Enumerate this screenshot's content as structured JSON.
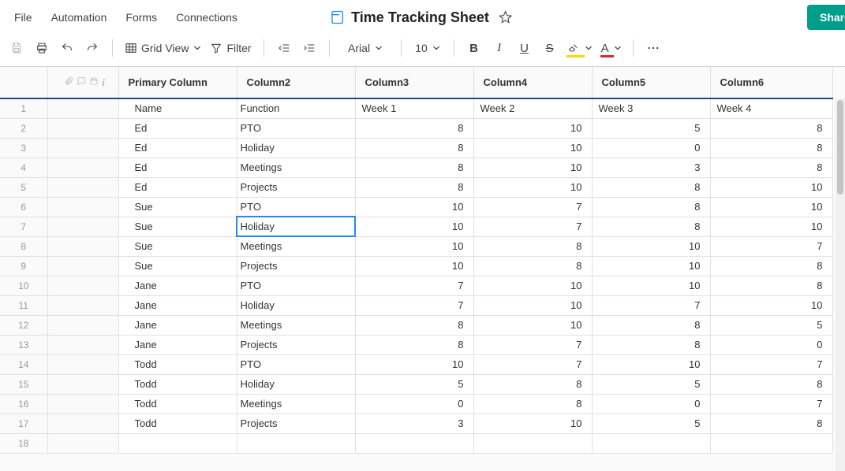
{
  "menu": {
    "file": "File",
    "automation": "Automation",
    "forms": "Forms",
    "connections": "Connections"
  },
  "title": "Time Tracking Sheet",
  "share_label": "Share",
  "toolbar": {
    "grid_view": "Grid View",
    "filter": "Filter",
    "font_family": "Arial",
    "font_size": "10",
    "highlight_color": "#ffd600",
    "text_color": "#d32f2f"
  },
  "columns": [
    "Primary Column",
    "Column2",
    "Column3",
    "Column4",
    "Column5",
    "Column6"
  ],
  "selected": {
    "row": 7,
    "col": 2
  },
  "chart_data": {
    "type": "table",
    "columns": [
      "Name",
      "Function",
      "Week 1",
      "Week 2",
      "Week 3",
      "Week 4"
    ],
    "rows": [
      [
        "Name",
        "Function",
        "Week 1",
        "Week 2",
        "Week 3",
        "Week 4"
      ],
      [
        "Ed",
        "PTO",
        8,
        10,
        5,
        8
      ],
      [
        "Ed",
        "Holiday",
        8,
        10,
        0,
        8
      ],
      [
        "Ed",
        "Meetings",
        8,
        10,
        3,
        8
      ],
      [
        "Ed",
        "Projects",
        8,
        10,
        8,
        10
      ],
      [
        "Sue",
        "PTO",
        10,
        7,
        8,
        10
      ],
      [
        "Sue",
        "Holiday",
        10,
        7,
        8,
        10
      ],
      [
        "Sue",
        "Meetings",
        10,
        8,
        10,
        7
      ],
      [
        "Sue",
        "Projects",
        10,
        8,
        10,
        8
      ],
      [
        "Jane",
        "PTO",
        7,
        10,
        10,
        8
      ],
      [
        "Jane",
        "Holiday",
        7,
        10,
        7,
        10
      ],
      [
        "Jane",
        "Meetings",
        8,
        10,
        8,
        5
      ],
      [
        "Jane",
        "Projects",
        8,
        7,
        8,
        0
      ],
      [
        "Todd",
        "PTO",
        10,
        7,
        10,
        7
      ],
      [
        "Todd",
        "Holiday",
        5,
        8,
        5,
        8
      ],
      [
        "Todd",
        "Meetings",
        0,
        8,
        0,
        7
      ],
      [
        "Todd",
        "Projects",
        3,
        10,
        5,
        8
      ]
    ]
  },
  "empty_rows": [
    18
  ]
}
